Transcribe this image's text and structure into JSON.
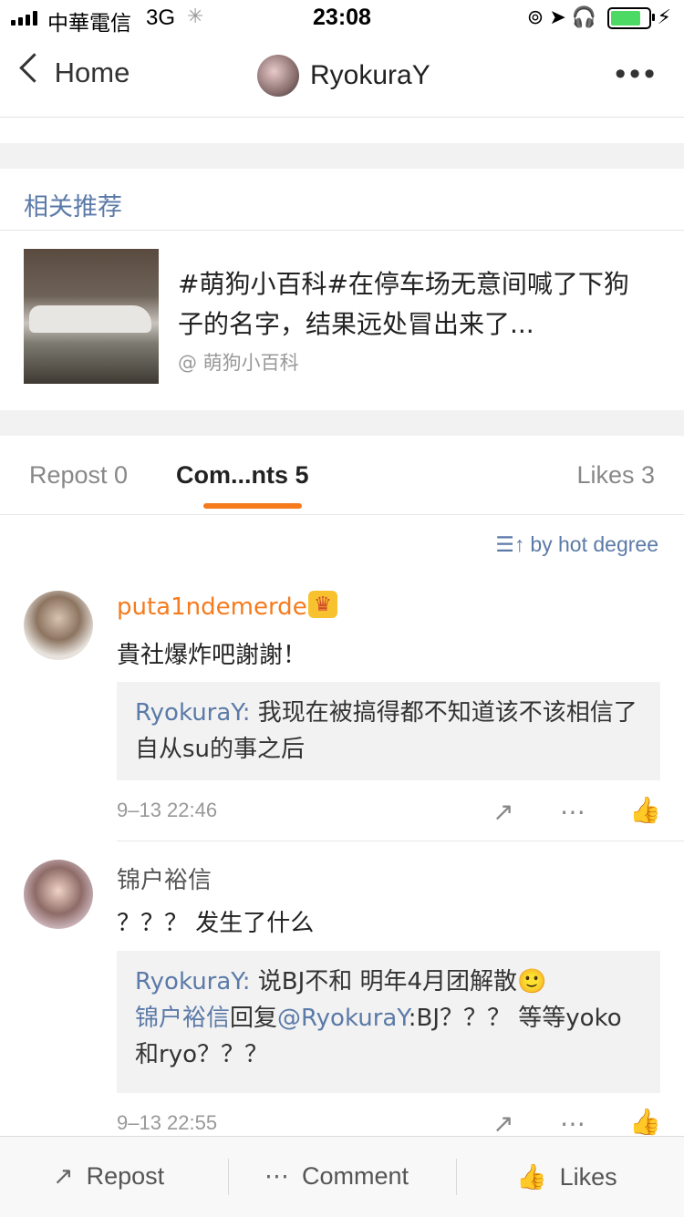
{
  "status_bar": {
    "carrier": "中華電信",
    "network": "3G",
    "time": "23:08",
    "battery_level": 0.72
  },
  "nav": {
    "back_label": "Home",
    "title": "RyokuraY"
  },
  "related": {
    "heading": "相关推荐",
    "item": {
      "title": "#萌狗小百科#在停车场无意间喊了下狗子的名字，结果远处冒出来了...",
      "source": "@ 萌狗小百科"
    }
  },
  "tabs": {
    "repost": "Repost 0",
    "comments": "Com...nts 5",
    "likes": "Likes 3"
  },
  "sort_label": "by hot degree",
  "comments": [
    {
      "user": "puta1ndemerde",
      "text": "貴社爆炸吧謝謝！",
      "reply_user": "RyokuraY:",
      "reply_text": " 我现在被搞得都不知道该不该相信了 自从su的事之后",
      "time": "9–13 22:46"
    },
    {
      "user": "锦户裕信",
      "text": "？？？ 发生了什么",
      "reply_user": "RyokuraY:",
      "reply_text": " 说BJ不和 明年4月团解散🙂",
      "reply2_user": "锦户裕信",
      "reply2_mid": "回复",
      "reply2_target": "@RyokuraY",
      "reply2_text": ":BJ？？？ 等等yoko和ryo？？？",
      "time": "9–13 22:55"
    }
  ],
  "toolbar": {
    "repost": "Repost",
    "comment": "Comment",
    "likes": "Likes"
  },
  "colors": {
    "accent": "#f57b1d",
    "link": "#5b7aa8"
  }
}
